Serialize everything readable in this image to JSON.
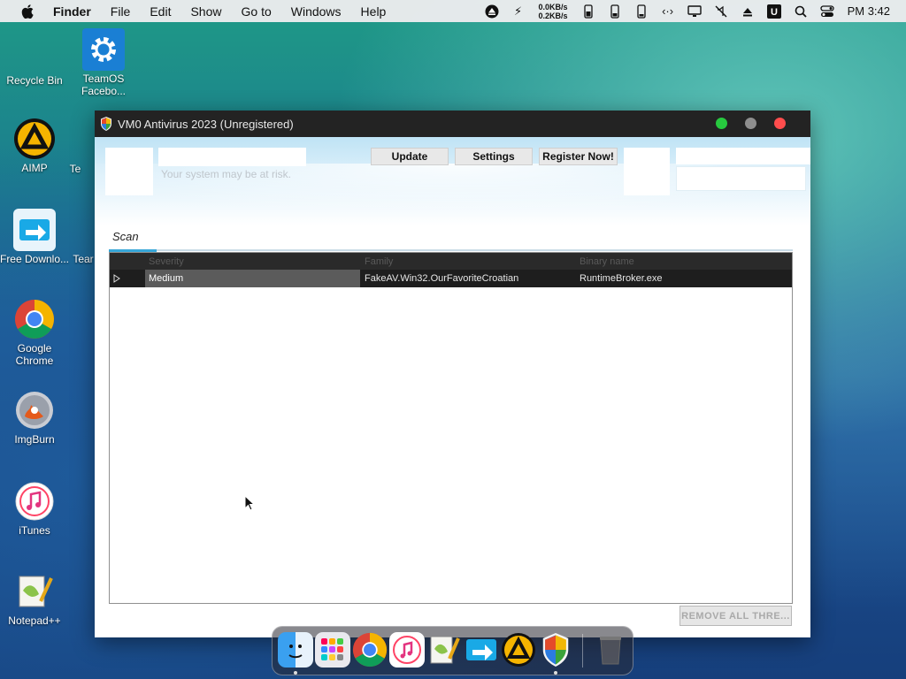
{
  "menubar": {
    "app": "Finder",
    "items": [
      "File",
      "Edit",
      "Show",
      "Go to",
      "Windows",
      "Help"
    ],
    "net_up": "0.0KB/s",
    "net_down": "0.2KB/s",
    "clock": "PM 3:42"
  },
  "desktop": {
    "icons": [
      "Recycle Bin",
      "TeamOS Facebo...",
      "AIMP",
      "Te",
      "Free Downlo...",
      "Tear",
      "Google Chrome",
      "ImgBurn",
      "iTunes",
      "Notepad++"
    ]
  },
  "window": {
    "title": "VM0 Antivirus 2023 (Unregistered)",
    "status_text": "Your system may be at risk.",
    "buttons": {
      "update": "Update",
      "settings": "Settings",
      "register": "Register Now!"
    },
    "tab": "Scan",
    "grid": {
      "columns": [
        "Severity",
        "Family",
        "Binary name"
      ],
      "rows": [
        {
          "severity": "Medium",
          "family": "FakeAV.Win32.OurFavoriteCroatian",
          "binary": "RuntimeBroker.exe"
        }
      ]
    },
    "remove_button": "REMOVE ALL THRE..."
  },
  "colors": {
    "titlebar": "#232323",
    "accent_tab": "#36a6d8",
    "traffic_green": "#27c93f",
    "traffic_gray": "#8e8e8e",
    "traffic_red": "#ff4d4d"
  }
}
